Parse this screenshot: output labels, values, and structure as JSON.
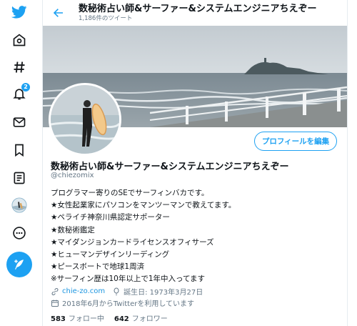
{
  "header": {
    "title": "数秘術占い師&サーファー&システムエンジニアちえぞー",
    "tweet_count": "1,186件のツイート"
  },
  "nav": {
    "notification_count": "2"
  },
  "profile": {
    "name": "数秘術占い師&サーファー&システムエンジニアちえぞー",
    "handle": "@chiezomix",
    "edit_label": "プロフィールを編集",
    "bio": [
      "プログラマー寄りのSEでサーフィンバカです。",
      "★女性起業家にパソコンをマンツーマンで教えてます。",
      "★ペライチ神奈川県認定サポーター",
      "★数秘術鑑定",
      "★マイダンジョンカードライセンスオフィサーズ",
      "★ヒューマンデザインリーディング",
      "★ピースボートで地球1周済",
      "※サーフィン歴は10年以上で1年中入ってます"
    ],
    "website": "chie-zo.com",
    "birthday": "誕生日: 1973年3月27日",
    "joined": "2018年6月からTwitterを利用しています",
    "following_count": "583",
    "following_label": "フォロー中",
    "followers_count": "642",
    "followers_label": "フォロワー"
  },
  "colors": {
    "accent": "#1da1f2",
    "secondary_text": "#657786"
  }
}
